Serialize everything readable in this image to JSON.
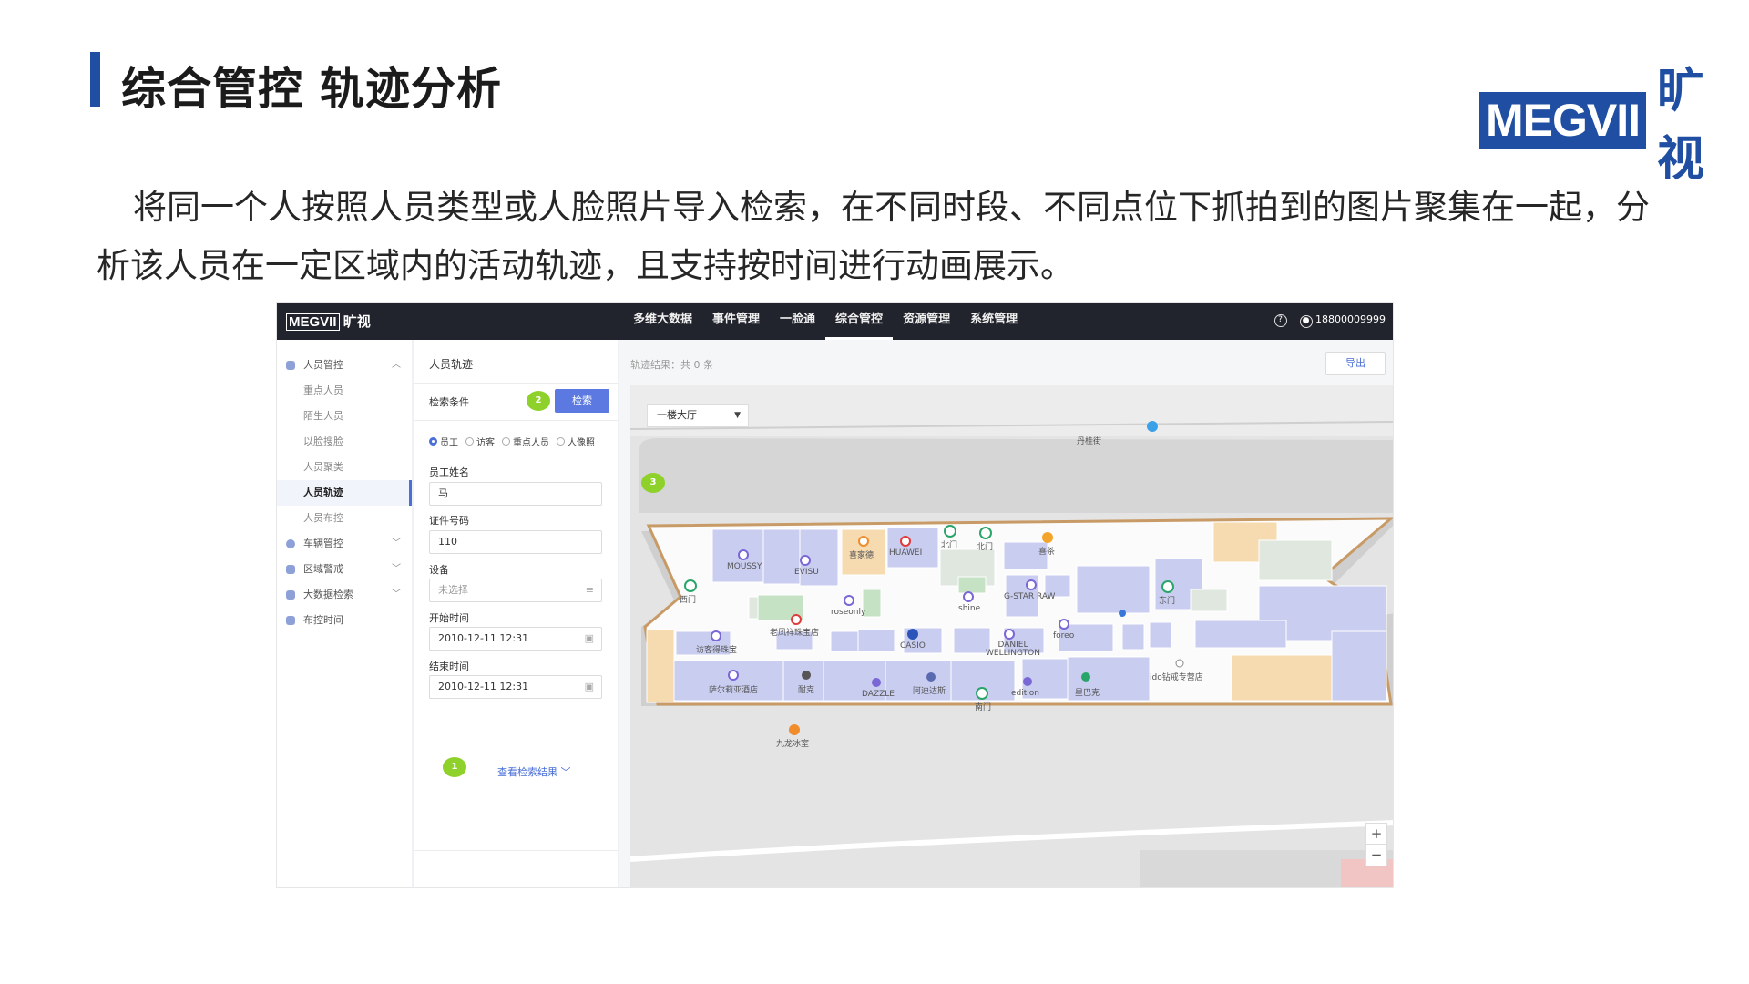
{
  "slide": {
    "title": "综合管控 轨迹分析",
    "logo_text": "MEGVII",
    "logo_cn": "旷视",
    "description": "将同一个人按照人员类型或人脸照片导入检索，在不同时段、不同点位下抓拍到的图片聚集在一起，分析该人员在一定区域内的活动轨迹，且支持按时间进行动画展示。"
  },
  "app": {
    "brand": "MEGVII",
    "brand_cn": "旷视",
    "nav": [
      "多维大数据",
      "事件管理",
      "一脸通",
      "综合管控",
      "资源管理",
      "系统管理"
    ],
    "nav_active": "综合管控",
    "help": "?",
    "user": "18800009999"
  },
  "sidebar": {
    "groups": [
      {
        "label": "人员管控",
        "expanded": true
      },
      {
        "label": "车辆管控"
      },
      {
        "label": "区域警戒"
      },
      {
        "label": "大数据检索"
      },
      {
        "label": "布控时间"
      }
    ],
    "sub_items": [
      "重点人员",
      "陌生人员",
      "以脸搜脸",
      "人员聚类",
      "人员轨迹",
      "人员布控"
    ],
    "active": "人员轨迹"
  },
  "panel": {
    "title": "人员轨迹",
    "conditions_label": "检索条件",
    "search_button": "检索",
    "radio_options": [
      "员工",
      "访客",
      "重点人员",
      "人像照"
    ],
    "radio_selected": "员工",
    "fields": {
      "name_label": "员工姓名",
      "name_value": "马",
      "id_label": "证件号码",
      "id_value": "110",
      "device_label": "设备",
      "device_placeholder": "未选择",
      "start_label": "开始时间",
      "start_value": "2010-12-11 12:31",
      "end_label": "结束时间",
      "end_value": "2010-12-11 12:31"
    },
    "view_results": "查看检索结果"
  },
  "badges": [
    "1",
    "2",
    "3"
  ],
  "content": {
    "result_count": "轨迹结果：共 0 条",
    "export_button": "导出",
    "floor": "一楼大厅",
    "zoom_in": "+",
    "zoom_out": "−"
  },
  "map_labels": [
    "丹桂街",
    "MOUSSY",
    "EVISU",
    "喜家德",
    "HUAWEI",
    "北门",
    "北门",
    "喜茶",
    "西门",
    "G-STAR RAW",
    "东门",
    "roseonly",
    "shine",
    "老凤祥珠宝店",
    "访客得珠宝",
    "CASIO",
    "DANIEL WELLINGTON",
    "foreo",
    "ido钻戒专营店",
    "萨尔莉亚酒店",
    "耐克",
    "DAZZLE",
    "阿迪达斯",
    "edition",
    "星巴克",
    "南门",
    "九龙冰室"
  ],
  "colors": {
    "brand_blue": "#1f4ea2",
    "nav_bg": "#21242c",
    "accent": "#5b79e0",
    "badge_green": "#8ed12a",
    "store_purple": "#c9cdf0",
    "store_orange": "#f6dbb0"
  }
}
